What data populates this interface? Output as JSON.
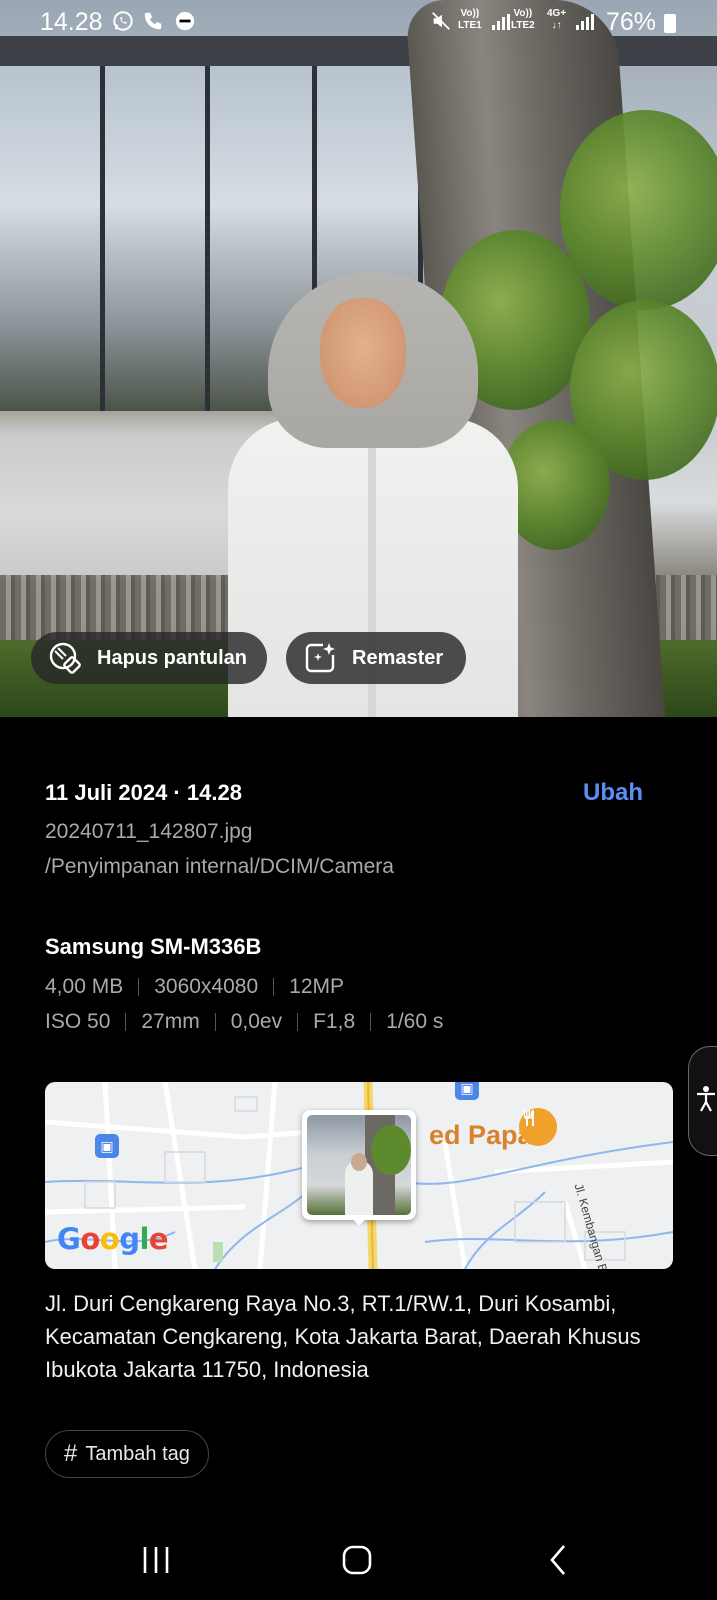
{
  "status_bar": {
    "time": "14.28",
    "sim1": "LTE1",
    "sim2": "LTE2",
    "network": "4G+",
    "battery": "76%",
    "icons": [
      "whatsapp-icon",
      "phone-icon",
      "do-not-disturb-icon",
      "mute-icon",
      "signal-icon",
      "battery-icon"
    ]
  },
  "photo_actions": {
    "remove_reflection": "Hapus pantulan",
    "remaster": "Remaster"
  },
  "details": {
    "date_time": "11 Juli 2024 · 14.28",
    "edit_label": "Ubah",
    "filename": "20240711_142807.jpg",
    "path": "/Penyimpanan internal/DCIM/Camera",
    "device": "Samsung SM-M336B",
    "specs_row1": [
      "4,00 MB",
      "3060x4080",
      "12MP"
    ],
    "specs_row2": [
      "ISO 50",
      "27mm",
      "0,0ev",
      "F1,8",
      "1/60 s"
    ]
  },
  "map": {
    "place_label": "ed Papa",
    "street_label": "Jl. Kembangan Baru",
    "logo": "Google"
  },
  "address": "Jl. Duri Cengkareng Raya No.3, RT.1/RW.1, Duri Kosambi, Kecamatan Cengkareng, Kota Jakarta Barat, Daerah Khusus Ibukota Jakarta 11750, Indonesia",
  "tag_button": {
    "label": "Tambah tag",
    "icon": "#"
  },
  "colors": {
    "accent": "#5b8ff3",
    "secondary_text": "#a9a9a9",
    "background": "#000000"
  },
  "navigation": {
    "buttons": [
      "recent-apps",
      "home",
      "back"
    ]
  }
}
